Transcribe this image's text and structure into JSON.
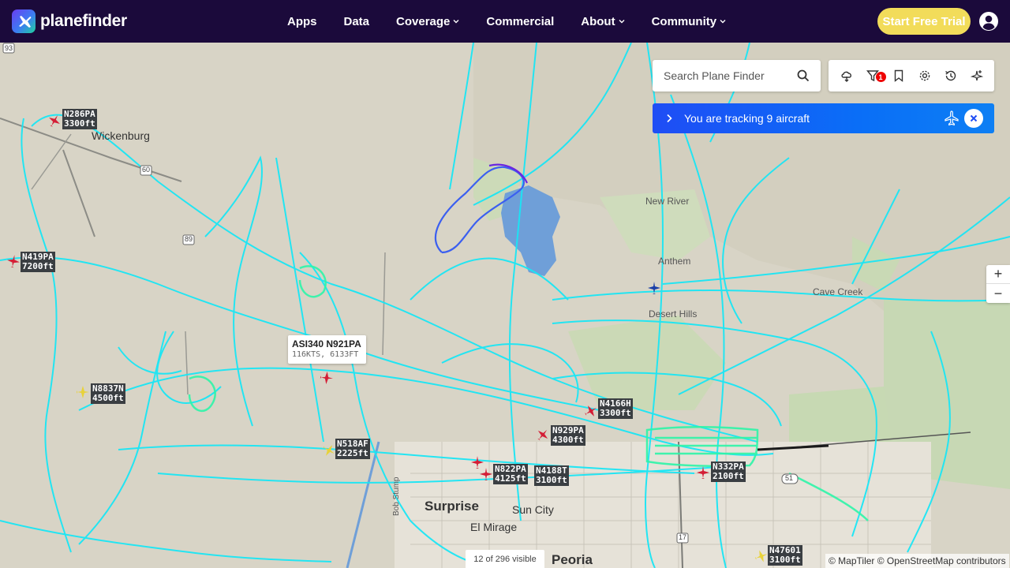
{
  "brand": {
    "name": "planefinder"
  },
  "nav": {
    "links": [
      {
        "label": "Apps",
        "dropdown": false
      },
      {
        "label": "Data",
        "dropdown": false
      },
      {
        "label": "Coverage",
        "dropdown": true
      },
      {
        "label": "Commercial",
        "dropdown": false
      },
      {
        "label": "About",
        "dropdown": true
      },
      {
        "label": "Community",
        "dropdown": true
      }
    ],
    "cta": "Start Free Trial"
  },
  "search": {
    "placeholder": "Search Plane Finder"
  },
  "toolbar": {
    "icons": [
      "weather-icon",
      "filter-icon",
      "bookmark-icon",
      "settings-icon",
      "history-icon",
      "tracking-icon"
    ],
    "filter_badge": "1"
  },
  "tracking": {
    "text": "You are tracking 9 aircraft"
  },
  "tooltip": {
    "title": "ASI340 N921PA",
    "detail": "116KTS, 6133FT"
  },
  "aircraft": [
    {
      "reg": "N286PA",
      "alt": "3300ft"
    },
    {
      "reg": "N419PA",
      "alt": "7200ft"
    },
    {
      "reg": "N8837N",
      "alt": "4500ft"
    },
    {
      "reg": "N518AF",
      "alt": "2225ft"
    },
    {
      "reg": "N4166H",
      "alt": "3300ft"
    },
    {
      "reg": "N929PA",
      "alt": "4300ft"
    },
    {
      "reg": "N822PA",
      "alt": "4125ft"
    },
    {
      "reg": "N4188T",
      "alt": "3100ft"
    },
    {
      "reg": "N332PA",
      "alt": "2100ft"
    },
    {
      "reg": "N47601",
      "alt": "3100ft"
    }
  ],
  "places": {
    "wickenburg": "Wickenburg",
    "new_river": "New River",
    "anthem": "Anthem",
    "desert_hills": "Desert Hills",
    "cave_creek": "Cave Creek",
    "surprise": "Surprise",
    "sun_city": "Sun City",
    "el_mirage": "El Mirage",
    "peoria": "Peoria",
    "bob_stump": "Bob Stump",
    "hwy_93": "93",
    "hwy_60": "60",
    "hwy_17": "17",
    "hwy_51": "51",
    "hwy_89": "89"
  },
  "zoom": {
    "in": "+",
    "out": "−"
  },
  "map_status": {
    "visible": "12 of 296 visible"
  },
  "attribution": {
    "maptiler": "© MapTiler",
    "osm": "© OpenStreetMap contributors"
  },
  "colors": {
    "nav_bg": "#1b0a3b",
    "cta": "#f2dc5a",
    "tracking_bar": "#1f4df5",
    "track_cyan": "#19e6f5",
    "track_green": "#2ef5a8"
  }
}
